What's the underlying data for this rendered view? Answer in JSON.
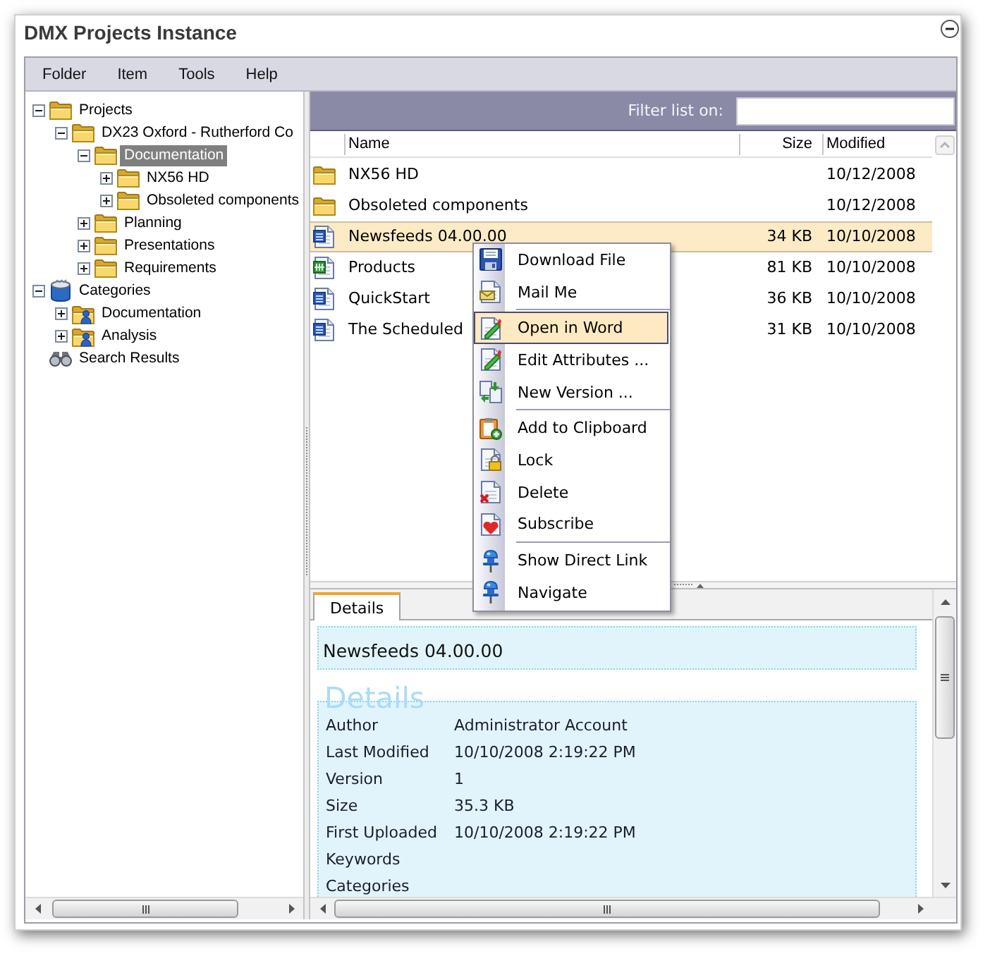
{
  "window": {
    "title": "DMX Projects Instance"
  },
  "menu_bar": {
    "items": [
      "Folder",
      "Item",
      "Tools",
      "Help"
    ]
  },
  "tree": [
    {
      "kind": "folder",
      "label": "Projects",
      "expanded": true,
      "selected": false,
      "children": [
        {
          "kind": "folder",
          "label": "DX23 Oxford - Rutherford Co",
          "expanded": true,
          "selected": false,
          "children": [
            {
              "kind": "folder",
              "label": "Documentation",
              "expanded": true,
              "selected": true,
              "children": [
                {
                  "kind": "folder",
                  "label": "NX56 HD",
                  "expanded": false,
                  "selected": false
                },
                {
                  "kind": "folder",
                  "label": "Obsoleted components",
                  "expanded": false,
                  "selected": false
                }
              ]
            },
            {
              "kind": "folder",
              "label": "Planning",
              "expanded": false,
              "selected": false
            },
            {
              "kind": "folder",
              "label": "Presentations",
              "expanded": false,
              "selected": false
            },
            {
              "kind": "folder",
              "label": "Requirements",
              "expanded": false,
              "selected": false
            }
          ]
        }
      ]
    },
    {
      "kind": "categories",
      "label": "Categories",
      "expanded": true,
      "selected": false,
      "children": [
        {
          "kind": "category",
          "label": "Documentation",
          "expanded": false,
          "selected": false
        },
        {
          "kind": "category",
          "label": "Analysis",
          "expanded": false,
          "selected": false
        }
      ]
    },
    {
      "kind": "search",
      "label": "Search Results",
      "selected": false
    }
  ],
  "filter": {
    "label": "Filter list on:"
  },
  "file_list": {
    "columns": [
      "Name",
      "Size",
      "Modified"
    ],
    "rows": [
      {
        "kind": "folder",
        "name": "NX56 HD",
        "modified": "10/12/2008",
        "selected": false
      },
      {
        "kind": "folder",
        "name": "Obsoleted components",
        "modified": "10/12/2008",
        "selected": false
      },
      {
        "kind": "word",
        "name": "Newsfeeds 04.00.00",
        "size": "34 KB",
        "modified": "10/10/2008",
        "selected": true
      },
      {
        "kind": "excel",
        "name": "Products",
        "size": "81 KB",
        "modified": "10/10/2008",
        "selected": false
      },
      {
        "kind": "word",
        "name": "QuickStart",
        "size": "36 KB",
        "modified": "10/10/2008",
        "selected": false
      },
      {
        "kind": "word",
        "name": "The Scheduled",
        "size": "31 KB",
        "modified": "10/10/2008",
        "selected": false
      }
    ]
  },
  "context_menu": {
    "groups": [
      {
        "items": [
          {
            "kind": "download",
            "label": "Download File",
            "selected": false
          },
          {
            "kind": "mail",
            "label": "Mail Me",
            "selected": false
          }
        ]
      },
      {
        "items": [
          {
            "kind": "edit",
            "label": "Open in Word",
            "selected": true
          },
          {
            "kind": "edit",
            "label": "Edit Attributes ...",
            "selected": false
          },
          {
            "kind": "version",
            "label": "New Version ...",
            "selected": false
          }
        ]
      },
      {
        "items": [
          {
            "kind": "clipboard",
            "label": "Add to Clipboard",
            "selected": false
          },
          {
            "kind": "lock",
            "label": "Lock",
            "selected": false
          },
          {
            "kind": "delete",
            "label": "Delete",
            "selected": false
          },
          {
            "kind": "subscribe",
            "label": "Subscribe",
            "selected": false
          }
        ]
      },
      {
        "items": [
          {
            "kind": "link",
            "label": "Show Direct Link",
            "selected": false
          },
          {
            "kind": "link",
            "label": "Navigate",
            "selected": false
          }
        ]
      }
    ]
  },
  "details": {
    "tabs": [
      {
        "label": "Details",
        "selected": true
      }
    ],
    "title": "Newsfeeds 04.00.00",
    "section_heading": "Details",
    "properties": [
      {
        "label": "Author",
        "value": "Administrator Account"
      },
      {
        "label": "Last Modified",
        "value": "10/10/2008 2:19:22 PM"
      },
      {
        "label": "Version",
        "value": "1"
      },
      {
        "label": "Size",
        "value": "35.3 KB"
      },
      {
        "label": "First Uploaded",
        "value": "10/10/2008 2:19:22 PM"
      },
      {
        "label": "Keywords"
      },
      {
        "label": "Categories"
      }
    ]
  }
}
